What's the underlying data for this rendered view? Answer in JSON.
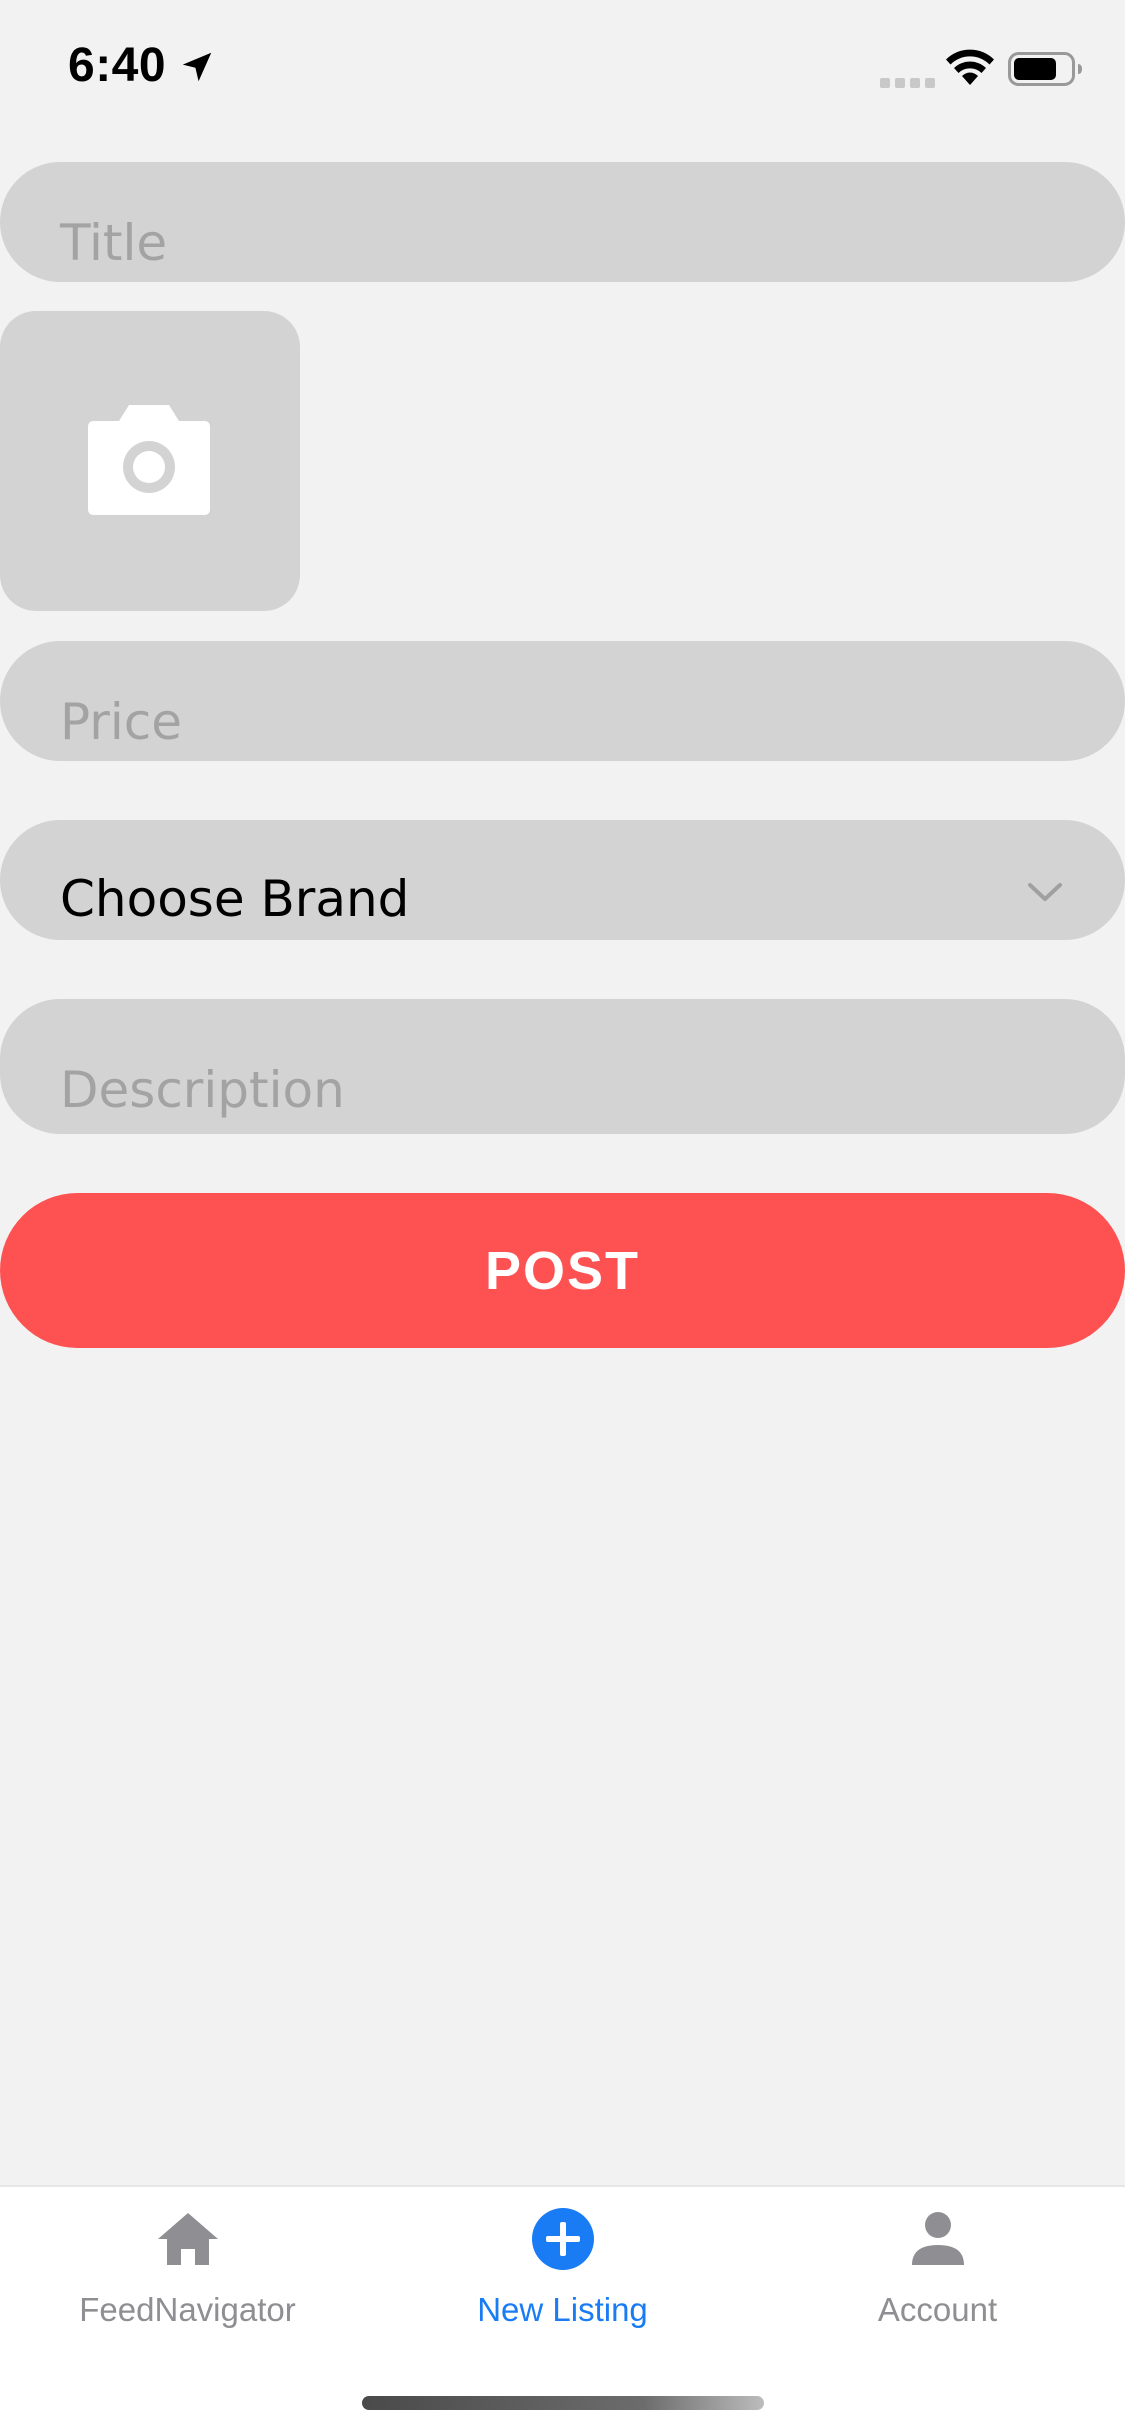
{
  "status_bar": {
    "time": "6:40",
    "icons": [
      "location-arrow-icon",
      "signal-icon",
      "wifi-icon",
      "battery-icon"
    ]
  },
  "form": {
    "title_placeholder": "Title",
    "photo_icon": "camera-icon",
    "price_placeholder": "Price",
    "brand_select": {
      "selected": "Choose Brand",
      "icon": "chevron-down-icon"
    },
    "description_placeholder": "Description",
    "post_label": "POST"
  },
  "tab_bar": {
    "tabs": [
      {
        "label": "FeedNavigator",
        "icon": "home-icon",
        "active": false
      },
      {
        "label": "New Listing",
        "icon": "plus-circle-icon",
        "active": true
      },
      {
        "label": "Account",
        "icon": "person-icon",
        "active": false
      }
    ]
  },
  "colors": {
    "background": "#f2f2f2",
    "field": "#d3d3d3",
    "placeholder": "#a3a3a3",
    "post_button": "#fe5252",
    "tab_active": "#1a7cf5",
    "tab_inactive": "#8e8e93"
  }
}
